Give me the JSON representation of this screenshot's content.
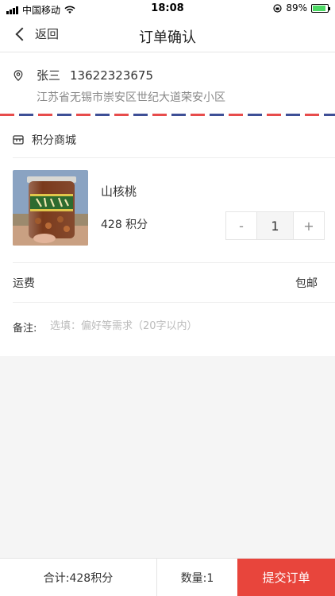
{
  "status_bar": {
    "carrier": "中国移动",
    "time": "18:08",
    "battery_percent": "89%",
    "battery_level": 0.89,
    "icons": [
      "signal-icon",
      "wifi-icon",
      "orientation-lock-icon",
      "battery-icon"
    ]
  },
  "nav": {
    "back_label": "返回",
    "title": "订单确认"
  },
  "address": {
    "name": "张三",
    "phone": "13622323675",
    "detail": "江苏省无锡市崇安区世纪大道荣安小区"
  },
  "shop": {
    "name": "积分商城"
  },
  "product": {
    "name": "山核桃",
    "price": "428 积分",
    "quantity": "1",
    "decrement_label": "-",
    "increment_label": "+",
    "image_label": "山核桃仁"
  },
  "shipping": {
    "label": "运费",
    "value": "包邮"
  },
  "remark": {
    "label": "备注:",
    "placeholder": "选填：偏好等需求（20字以内）",
    "value": ""
  },
  "footer": {
    "total": "合计:428积分",
    "quantity": "数量:1",
    "submit_label": "提交订单"
  },
  "colors": {
    "accent": "#e8453c",
    "airmail_red": "#e74c4c",
    "airmail_blue": "#3e4f96",
    "background": "#f5f5f5"
  }
}
